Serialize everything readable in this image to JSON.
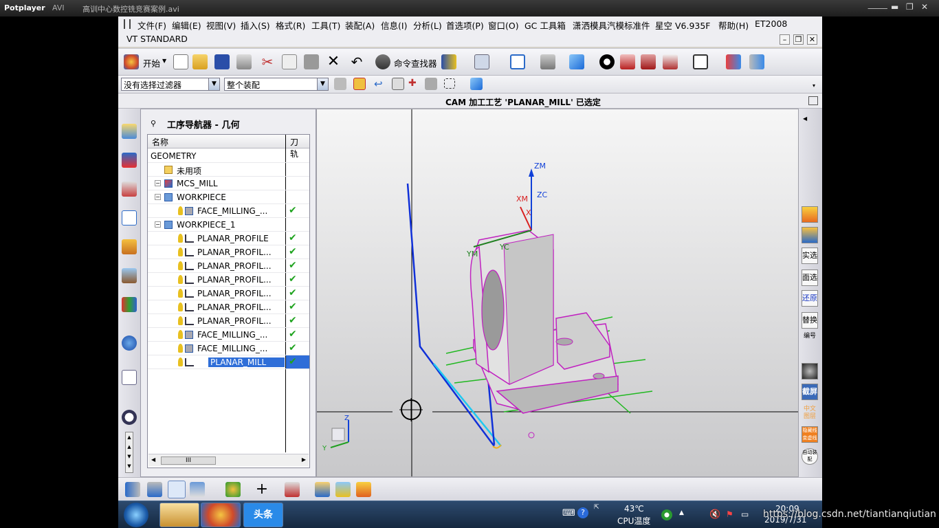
{
  "player": {
    "brand": "Potplayer",
    "format": "AVI",
    "file_title": "高训中心数控铣竞赛案例.avi",
    "controls": [
      "⸻",
      "▬",
      "❐",
      "✕"
    ]
  },
  "menu": [
    "文件(F)",
    "编辑(E)",
    "视图(V)",
    "插入(S)",
    "格式(R)",
    "工具(T)",
    "装配(A)",
    "信息(I)",
    "分析(L)",
    "首选项(P)",
    "窗口(O)",
    "GC 工具箱",
    "潇洒模具汽模标准件",
    "星空 V6.935F",
    "帮助(H)",
    "ET2008"
  ],
  "window": {
    "title": "VT STANDARD"
  },
  "toolbar": {
    "start_label": "开始",
    "command_finder_label": "命令查找器"
  },
  "filters": {
    "selection_filter": "没有选择过滤器",
    "assembly_scope": "整个装配"
  },
  "status": {
    "message": "CAM 加工工艺 'PLANAR_MILL' 已选定"
  },
  "navigator": {
    "title": "工序导航器 - 几何",
    "columns": {
      "name": "名称",
      "tool": "刀轨"
    },
    "rows": [
      {
        "label": "GEOMETRY",
        "indent": 0,
        "icon": "none",
        "check": ""
      },
      {
        "label": "未用项",
        "indent": 1,
        "icon": "folder",
        "check": ""
      },
      {
        "label": "MCS_MILL",
        "indent": 1,
        "icon": "mcs",
        "check": ""
      },
      {
        "label": "WORKPIECE",
        "indent": 2,
        "icon": "box",
        "check": ""
      },
      {
        "label": "FACE_MILLING_...",
        "indent": 3,
        "icon": "face",
        "check": "✔"
      },
      {
        "label": "WORKPIECE_1",
        "indent": 2,
        "icon": "box",
        "check": ""
      },
      {
        "label": "PLANAR_PROFILE",
        "indent": 3,
        "icon": "op",
        "check": "✔"
      },
      {
        "label": "PLANAR_PROFIL...",
        "indent": 3,
        "icon": "op",
        "check": "✔"
      },
      {
        "label": "PLANAR_PROFIL...",
        "indent": 3,
        "icon": "op",
        "check": "✔"
      },
      {
        "label": "PLANAR_PROFIL...",
        "indent": 3,
        "icon": "op",
        "check": "✔"
      },
      {
        "label": "PLANAR_PROFIL...",
        "indent": 3,
        "icon": "op",
        "check": "✔"
      },
      {
        "label": "PLANAR_PROFIL...",
        "indent": 3,
        "icon": "op",
        "check": "✔"
      },
      {
        "label": "PLANAR_PROFIL...",
        "indent": 3,
        "icon": "op",
        "check": "✔"
      },
      {
        "label": "FACE_MILLING_...",
        "indent": 3,
        "icon": "face",
        "check": "✔"
      },
      {
        "label": "FACE_MILLING_...",
        "indent": 3,
        "icon": "face",
        "check": "✔"
      },
      {
        "label": "PLANAR_MILL",
        "indent": 3,
        "icon": "op",
        "check": "✔",
        "selected": true
      }
    ],
    "scroll_thumb": "III"
  },
  "axes": {
    "zm": "ZM",
    "zc": "ZC",
    "xm": "XM",
    "xc": "X",
    "ym": "YM",
    "yc": "YC",
    "tri_z": "Z",
    "tri_y": "Y"
  },
  "right_buttons": [
    "实选",
    "面选",
    "还原",
    "替换",
    "编号",
    "截屏",
    "中文图层",
    "隐藏线变虚线",
    "自动装配"
  ],
  "taskbar": {
    "app_label": "头条",
    "temp": "43℃",
    "temp_label": "CPU温度",
    "time": "20:09",
    "date": "2019/7/31"
  },
  "watermark": "https://blog.csdn.net/tiantianqiutian"
}
